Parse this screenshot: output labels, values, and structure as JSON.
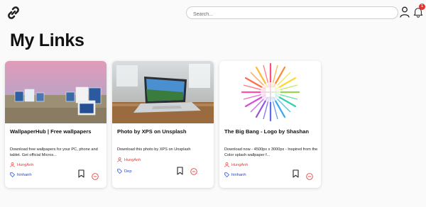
{
  "header": {
    "search_placeholder": "Search...",
    "notification_count": "1"
  },
  "page": {
    "title": "My Links"
  },
  "cards": [
    {
      "title": "WallpaperHub | Free wallpapers",
      "description": "Download free wallpapers for your PC, phone and tablet. Get official Micros...",
      "author": "HungAnh",
      "tag": "hinhanh"
    },
    {
      "title": "Photo by XPS on Unsplash",
      "description": "Download this photo by XPS on Unsplash",
      "author": "HungAnh",
      "tag": "Dep"
    },
    {
      "title": "The Big Bang - Logo by Shashan",
      "description": "Download now - 4500px x 3000px - Inspired from the Color splash wallpaper f...",
      "author": "HungAnh",
      "tag": "hinhanh"
    }
  ],
  "colors": {
    "author": "#e0413a",
    "tag": "#2747c4",
    "badge": "#e5322d",
    "remove": "#e0413a"
  },
  "icons": [
    "link-logo-icon",
    "user-icon",
    "bell-icon",
    "user-small-icon",
    "tag-icon",
    "bookmark-icon",
    "remove-circle-icon"
  ]
}
